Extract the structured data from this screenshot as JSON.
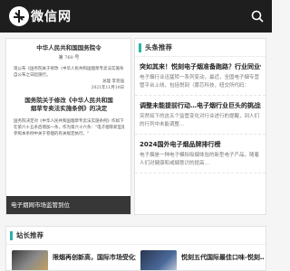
{
  "header": {
    "logo_text": "微信网",
    "brand_color": "#1e1e1e"
  },
  "featured": {
    "caption": "电子烟网市场监管到位",
    "doc": {
      "title": "中华人民共和国国务院令",
      "number": "第 760 号",
      "lines": [
        "现公布《国务院关于修改〈中华人民共和国烟草专卖法实施条例〉的决定》，",
        "自公布之日起施行。"
      ],
      "sign": "总理 李克强",
      "date": "2021年11月10日",
      "title2_line1": "国务院关于修改《中华人民共和国",
      "title2_line2": "烟草专卖法实施条例》的决定",
      "lines2": [
        "国务院决定对《中华人民共和国烟草专卖法实施条例》作如下修改：",
        "在第六十五条后增加一条，作为第六十六条：\"电子烟等新型烟草制品",
        "参照本条例中关于卷烟的有关规定执行。\""
      ]
    }
  },
  "news": {
    "heading": "头条推荐",
    "accent": "#2ab3a8",
    "items": [
      {
        "title": "突如其来！悦刻电子烟准备跑路？行业同业俱乐…",
        "summary": "电子烟行业迅猛转一系列变动，最近，全国电子烟专营管平台上线，包括悦刻（雾芯科技，纽交所代码：RLX）…"
      },
      {
        "title": "调整未能提前行动…电子烟行业巨头的挑战来了",
        "summary": "突然如下的这五个监管变化对行业进行的提醒，到人们的行列中未能调整…"
      },
      {
        "title": "2024国外电子烟品牌排行榜",
        "summary": "电子烟是一种电子模拟吸烟体验的新型电子产品，随着人们对健康和戒烟意识的提高…"
      }
    ]
  },
  "recommend": {
    "heading": "站长推荐",
    "items": [
      {
        "title": "限烟再创新高，国际市场受化为…"
      },
      {
        "title": "悦刻五代国际最佳口味-悦刻…"
      }
    ]
  }
}
